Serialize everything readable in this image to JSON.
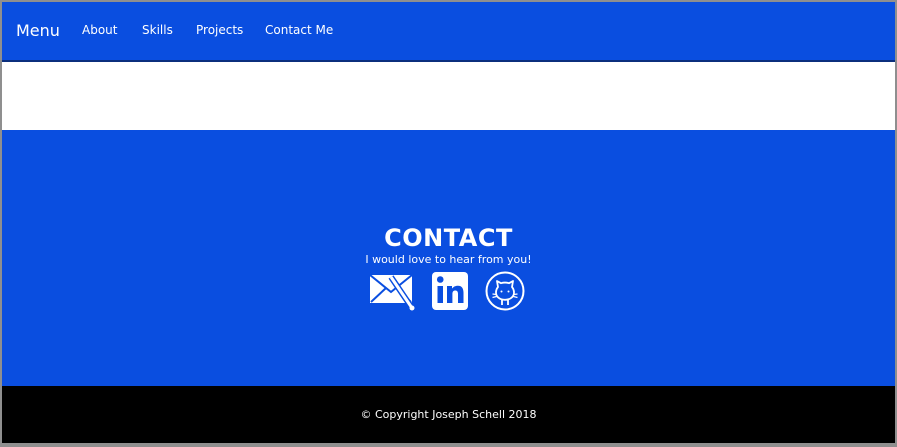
{
  "header": {
    "brand": "Menu",
    "nav": [
      {
        "label": "About"
      },
      {
        "label": "Skills"
      },
      {
        "label": "Projects"
      },
      {
        "label": "Contact Me"
      }
    ]
  },
  "contact": {
    "title": "CONTACT",
    "subtitle": "I would love to hear from you!",
    "icons": [
      "envelope-icon",
      "linkedin-icon",
      "github-icon"
    ]
  },
  "footer": {
    "copyright": "© Copyright Joseph Schell 2018"
  },
  "colors": {
    "primary": "#0A4EE0",
    "footer": "#000000",
    "text": "#FFFFFF"
  }
}
